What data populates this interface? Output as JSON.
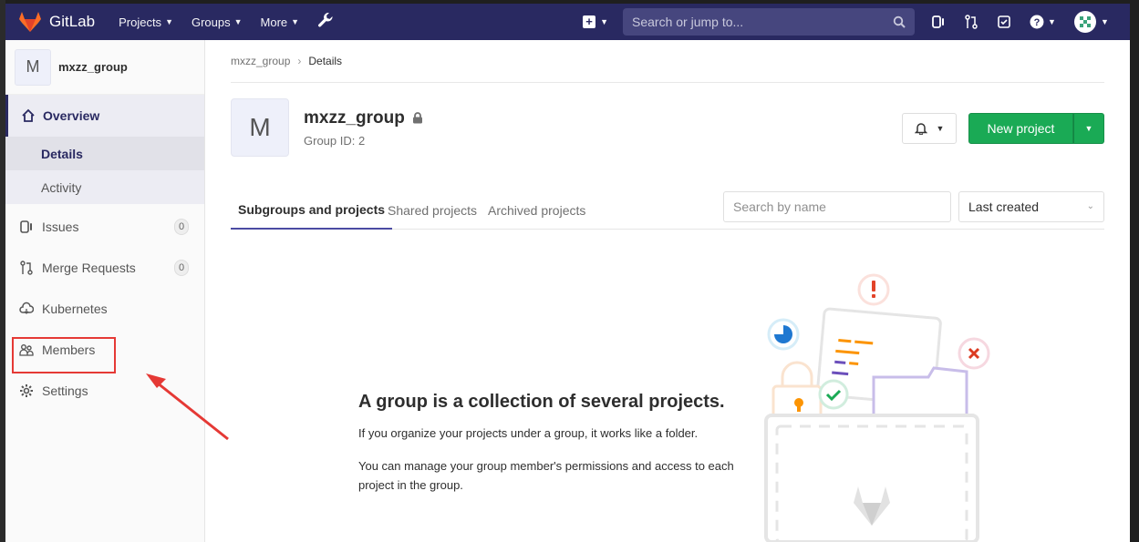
{
  "navbar": {
    "brand": "GitLab",
    "items": [
      {
        "label": "Projects"
      },
      {
        "label": "Groups"
      },
      {
        "label": "More"
      }
    ],
    "search_placeholder": "Search or jump to..."
  },
  "sidebar": {
    "group_initial": "M",
    "group_name": "mxzz_group",
    "overview": "Overview",
    "sub_items": [
      {
        "label": "Details"
      },
      {
        "label": "Activity"
      }
    ],
    "items": [
      {
        "label": "Issues",
        "count": "0"
      },
      {
        "label": "Merge Requests",
        "count": "0"
      },
      {
        "label": "Kubernetes"
      },
      {
        "label": "Members"
      },
      {
        "label": "Settings"
      }
    ]
  },
  "breadcrumb": {
    "parent": "mxzz_group",
    "current": "Details"
  },
  "group": {
    "initial": "M",
    "name": "mxzz_group",
    "id_text": "Group ID: 2"
  },
  "actions": {
    "new_project": "New project"
  },
  "tabs": [
    {
      "label": "Subgroups and projects"
    },
    {
      "label": "Shared projects"
    },
    {
      "label": "Archived projects"
    }
  ],
  "filter": {
    "search_placeholder": "Search by name",
    "sort_selected": "Last created"
  },
  "empty_state": {
    "title": "A group is a collection of several projects.",
    "line1": "If you organize your projects under a group, it works like a folder.",
    "line2": "You can manage your group member's permissions and access to each project in the group."
  },
  "colors": {
    "navbar": "#292961",
    "accent": "#292961",
    "primary_button": "#1aaa55",
    "annotation": "#e53935"
  }
}
